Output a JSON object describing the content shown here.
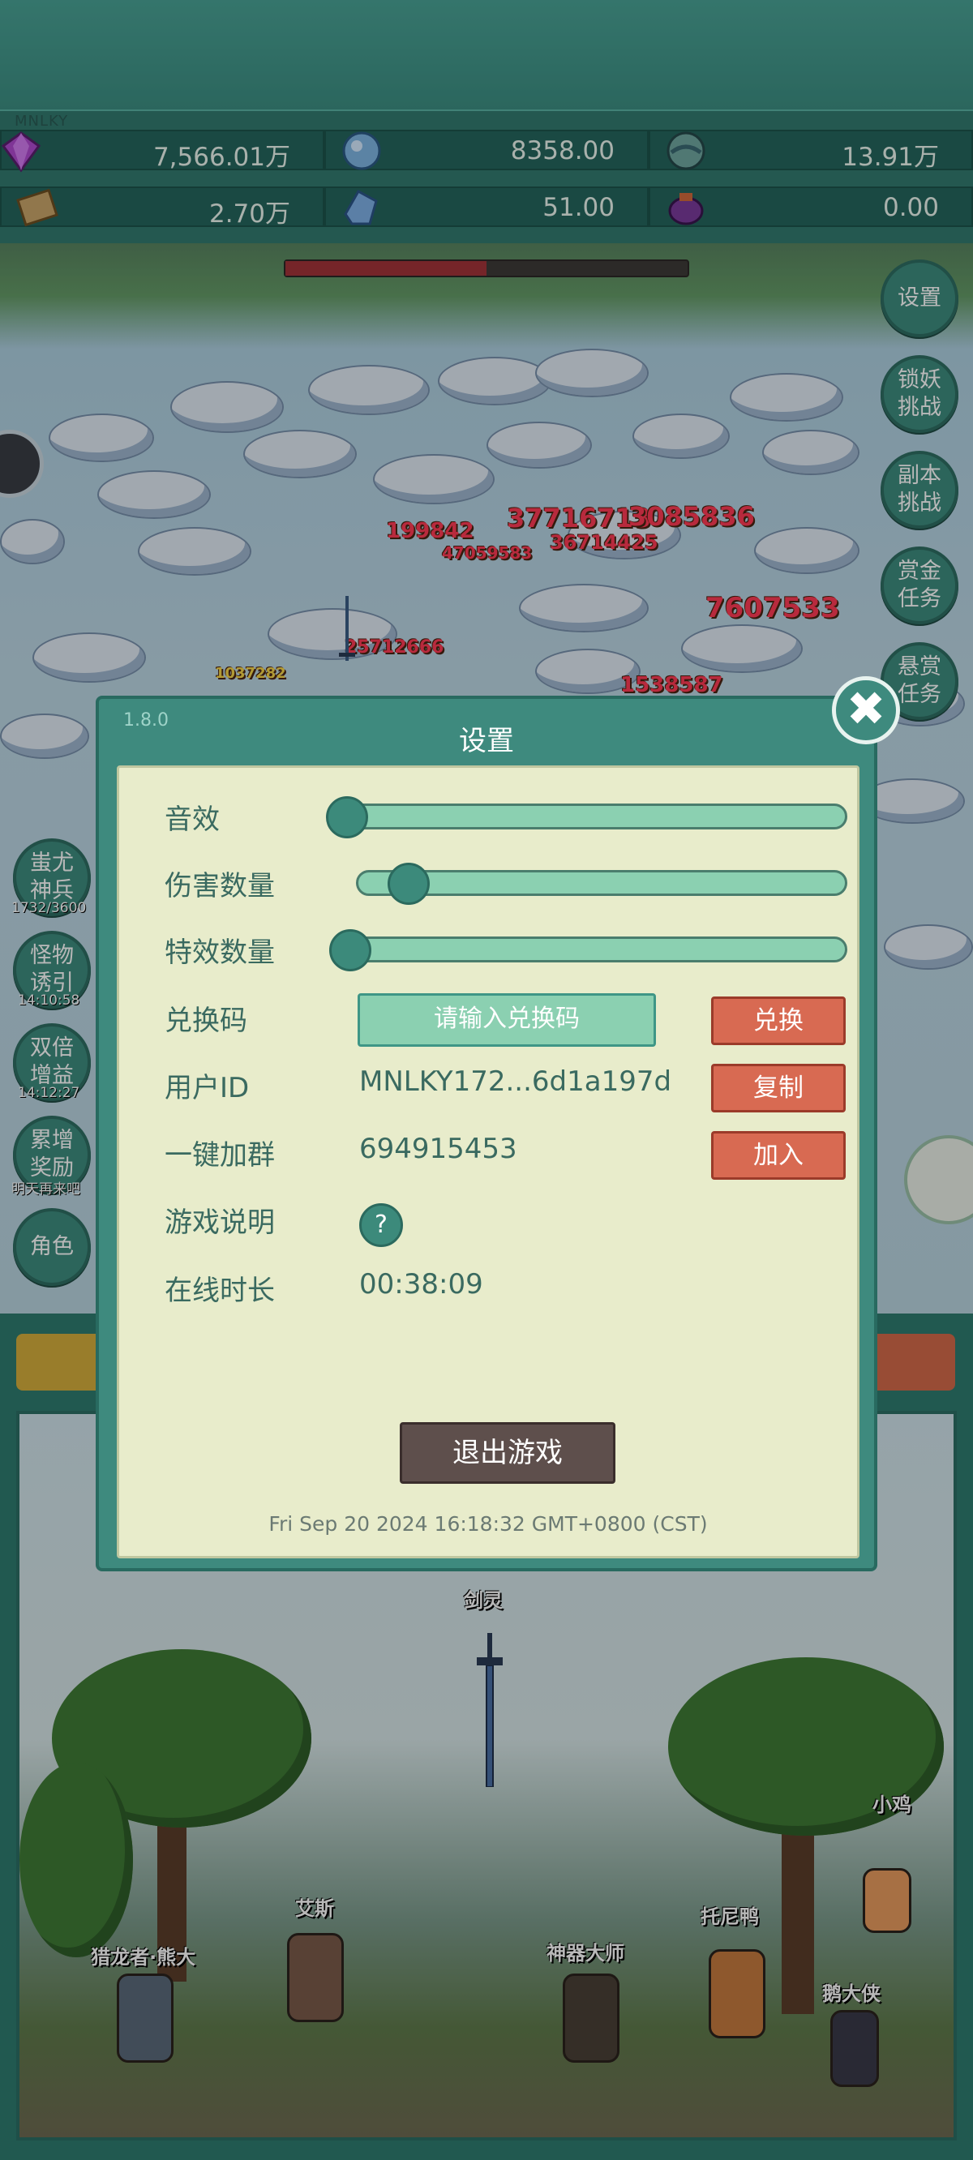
{
  "app_tag": "MNLKY",
  "resources": [
    {
      "icon": "gem-icon",
      "value": "7,566.01万"
    },
    {
      "icon": "ice-crystal-icon",
      "value": "8358.00"
    },
    {
      "icon": "orb-icon",
      "value": "13.91万"
    },
    {
      "icon": "scroll-book-icon",
      "value": "2.70万"
    },
    {
      "icon": "blue-shard-icon",
      "value": "51.00"
    },
    {
      "icon": "purple-pot-icon",
      "value": "0.00"
    }
  ],
  "right_buttons": [
    {
      "line1": "设置",
      "line2": ""
    },
    {
      "line1": "锁妖",
      "line2": "挑战"
    },
    {
      "line1": "副本",
      "line2": "挑战"
    },
    {
      "line1": "赏金",
      "line2": "任务"
    },
    {
      "line1": "悬赏",
      "line2": "任务"
    }
  ],
  "left_buttons": [
    {
      "line1": "蚩尤",
      "line2": "神兵",
      "caption": "1732/3600"
    },
    {
      "line1": "怪物",
      "line2": "诱引",
      "caption": "14:10:58"
    },
    {
      "line1": "双倍",
      "line2": "增益",
      "caption": "14:12:27"
    },
    {
      "line1": "累增",
      "line2": "奖励",
      "caption": "明天再来吧"
    },
    {
      "line1": "角色",
      "line2": "",
      "caption": ""
    }
  ],
  "damage_numbers": [
    "37716713",
    "3085836",
    "199842",
    "47059583",
    "36714425",
    "7607533",
    "25712666",
    "1037282",
    "1538587"
  ],
  "heroes": [
    "剑灵",
    "小鸡",
    "艾斯",
    "托尼鸭",
    "猎龙者·熊大",
    "神器大师",
    "鹅大侠"
  ],
  "dialog": {
    "version": "1.8.0",
    "title": "设置",
    "sound_label": "音效",
    "sound_level": 0.0,
    "damage_count_label": "伤害数量",
    "damage_count_level": 0.1,
    "effect_count_label": "特效数量",
    "effect_count_level": 0.0,
    "redeem_label": "兑换码",
    "redeem_placeholder": "请输入兑换码",
    "redeem_button": "兑换",
    "user_id_label": "用户ID",
    "user_id_value": "MNLKY172...6d1a197d",
    "copy_button": "复制",
    "group_label": "一键加群",
    "group_value": "694915453",
    "join_button": "加入",
    "help_label": "游戏说明",
    "help_icon": "?",
    "online_label": "在线时长",
    "online_value": "00:38:09",
    "exit_button": "退出游戏",
    "datetime": "Fri Sep 20 2024 16:18:32 GMT+0800 (CST)",
    "close_icon": "✖"
  }
}
